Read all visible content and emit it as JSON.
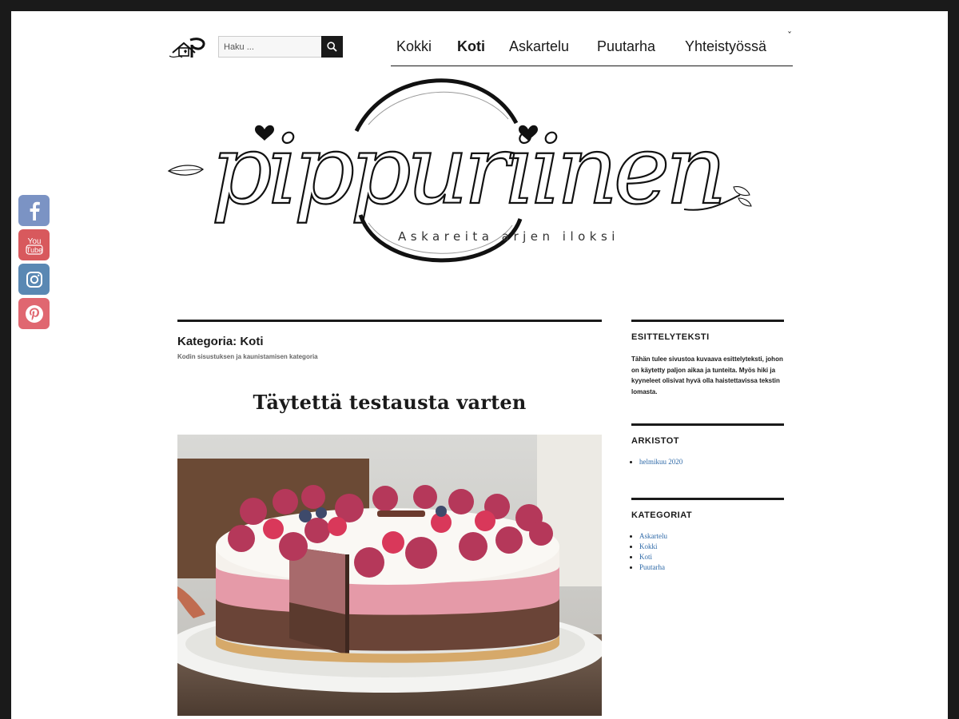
{
  "search": {
    "placeholder": "Haku ..."
  },
  "nav": {
    "items": [
      {
        "label": "Kokki"
      },
      {
        "label": "Koti"
      },
      {
        "label": "Askartelu"
      },
      {
        "label": "Puutarha"
      },
      {
        "label": "Yhteistyössä"
      }
    ],
    "chevron": "ˇ"
  },
  "logo": {
    "text": "pippuriinen",
    "tagline": "Askareita arjen iloksi"
  },
  "social": [
    {
      "name": "facebook",
      "color": "#7b93c4"
    },
    {
      "name": "youtube",
      "color": "#d8595d"
    },
    {
      "name": "instagram",
      "color": "#5a88b3"
    },
    {
      "name": "pinterest",
      "color": "#e06770"
    }
  ],
  "archive": {
    "title": "Kategoria: Koti",
    "description": "Kodin sisustuksen ja kaunistamisen kategoria"
  },
  "post": {
    "title": "Täytettä testausta varten"
  },
  "sidebar": {
    "intro": {
      "title": "ESITTELYTEKSTI",
      "text": "Tähän tulee sivustoa kuvaava esittelyteksti, johon on käytetty paljon aikaa ja tunteita. Myös hiki ja kyyneleet olisivat hyvä olla haistettavissa tekstin lomasta."
    },
    "archives": {
      "title": "ARKISTOT",
      "items": [
        "helmikuu 2020"
      ]
    },
    "categories": {
      "title": "KATEGORIAT",
      "items": [
        "Askartelu",
        "Kokki",
        "Koti",
        "Puutarha"
      ]
    }
  }
}
